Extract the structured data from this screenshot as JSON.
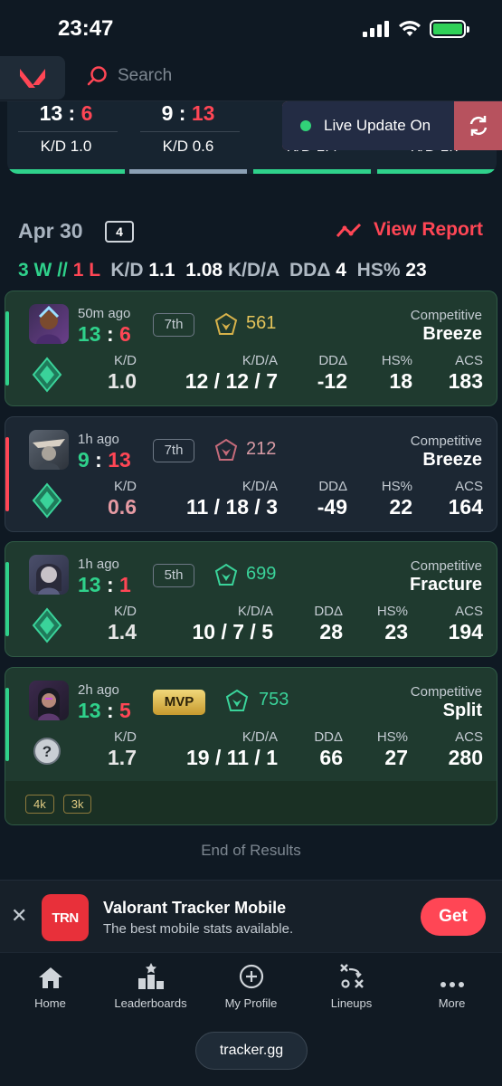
{
  "status_bar": {
    "time": "23:47"
  },
  "header": {
    "search_placeholder": "Search"
  },
  "strip": [
    {
      "score_left": "13",
      "score_right": "6",
      "kd": "K/D 1.0"
    },
    {
      "score_left": "9",
      "score_right": "13",
      "kd": "K/D 0.6"
    },
    {
      "kd": "K/D 1.4"
    },
    {
      "kd": "K/D 1.7"
    }
  ],
  "live_update": {
    "label": "Live Update On"
  },
  "day": {
    "date": "Apr 30",
    "count": "4",
    "view_report": "View Report",
    "summary": {
      "wins": "3 W",
      "sep": "//",
      "losses": "1 L",
      "kd_label": "K/D",
      "kd": "1.1",
      "kda": "1.08",
      "kda_label": "K/D/A",
      "dd_label": "DDΔ",
      "dd": "4",
      "hs_label": "HS%",
      "hs": "23"
    }
  },
  "labels": {
    "kd": "K/D",
    "kda": "K/D/A",
    "dd": "DDΔ",
    "hs": "HS%",
    "acs": "ACS"
  },
  "matches": [
    {
      "ago": "50m ago",
      "score_a": "13",
      "score_b": "6",
      "place": "7th",
      "rr": "561",
      "mode": "Competitive",
      "map": "Breeze",
      "kd": "1.0",
      "kda": "12 / 12 / 7",
      "dd": "-12",
      "hs": "18",
      "acs": "183",
      "result": "win"
    },
    {
      "ago": "1h ago",
      "score_a": "9",
      "score_b": "13",
      "place": "7th",
      "rr": "212",
      "mode": "Competitive",
      "map": "Breeze",
      "kd": "0.6",
      "kda": "11 / 18 / 3",
      "dd": "-49",
      "hs": "22",
      "acs": "164",
      "result": "loss"
    },
    {
      "ago": "1h ago",
      "score_a": "13",
      "score_b": "1",
      "place": "5th",
      "rr": "699",
      "mode": "Competitive",
      "map": "Fracture",
      "kd": "1.4",
      "kda": "10 / 7 / 5",
      "dd": "28",
      "hs": "23",
      "acs": "194",
      "result": "win"
    },
    {
      "ago": "2h ago",
      "score_a": "13",
      "score_b": "5",
      "place": "MVP",
      "rr": "753",
      "mode": "Competitive",
      "map": "Split",
      "kd": "1.7",
      "kda": "19 / 11 / 1",
      "dd": "66",
      "hs": "27",
      "acs": "280",
      "result": "win",
      "tags": [
        "4k",
        "3k"
      ]
    }
  ],
  "end_text": "End of Results",
  "promo": {
    "logo": "TRN",
    "title": "Valorant Tracker Mobile",
    "subtitle": "The best mobile stats available.",
    "button": "Get"
  },
  "nav": [
    "Home",
    "Leaderboards",
    "My Profile",
    "Lineups",
    "More"
  ],
  "url": "tracker.gg",
  "colors": {
    "accent_red": "#ff4655",
    "win_green": "#2fd18b",
    "background": "#0f1923"
  }
}
